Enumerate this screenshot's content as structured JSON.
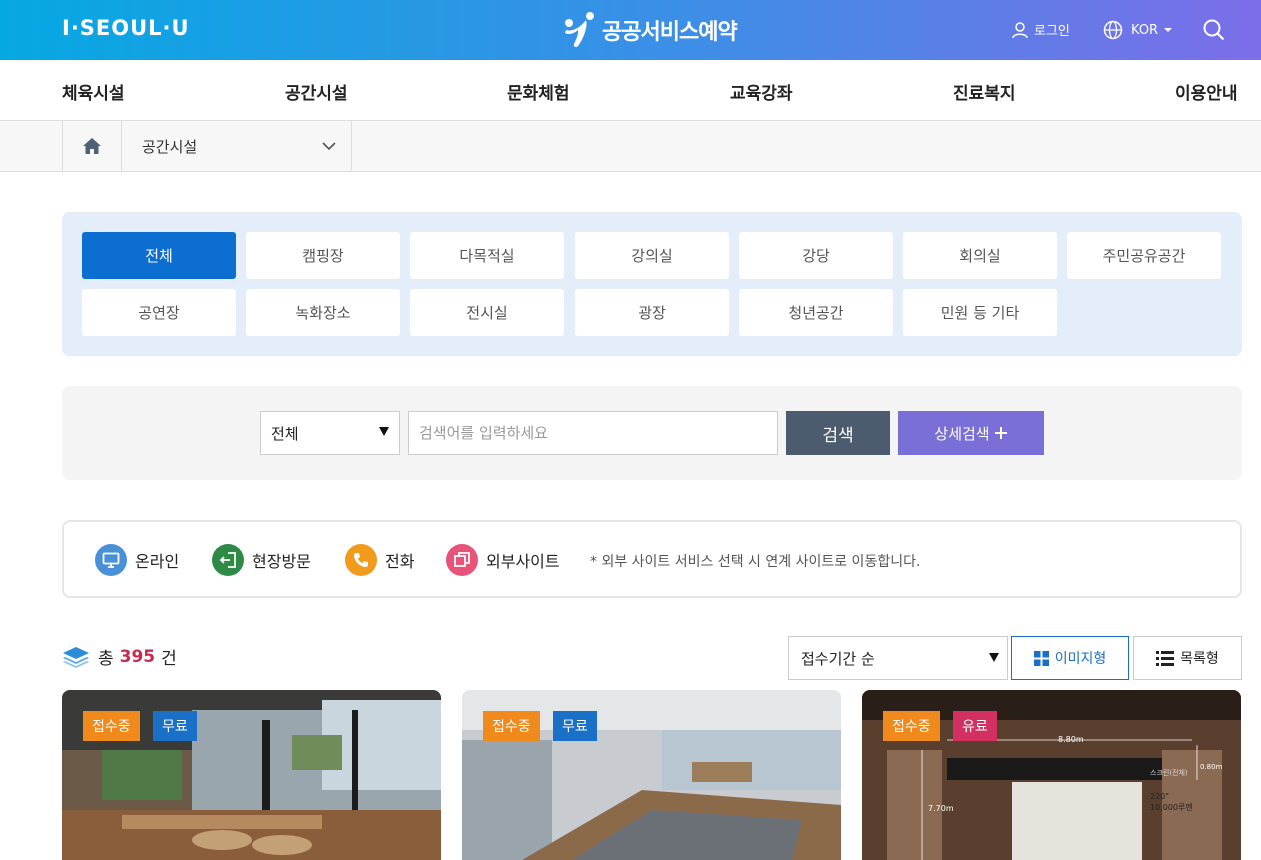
{
  "header": {
    "logo": "I·SEOUL·U",
    "brand": "공공서비스예약",
    "login": "로그인",
    "lang": "KOR"
  },
  "gnb": [
    "체육시설",
    "공간시설",
    "문화체험",
    "교육강좌",
    "진료복지",
    "이용안내"
  ],
  "breadcrumb": {
    "current": "공간시설"
  },
  "categories": [
    "전체",
    "캠핑장",
    "다목적실",
    "강의실",
    "강당",
    "회의실",
    "주민공유공간",
    "공연장",
    "녹화장소",
    "전시실",
    "광장",
    "청년공간",
    "민원 등 기타"
  ],
  "search": {
    "scope": "전체",
    "placeholder": "검색어를 입력하세요",
    "button": "검색",
    "detail": "상세검색"
  },
  "legend": {
    "online": "온라인",
    "visit": "현장방문",
    "phone": "전화",
    "external": "외부사이트",
    "note": "* 외부 사이트 서비스 선택 시 연계 사이트로 이동합니다."
  },
  "results": {
    "prefix": "총",
    "count": "395",
    "suffix": "건",
    "sort": "접수기간 순",
    "view_image": "이미지형",
    "view_list": "목록형"
  },
  "cards": [
    {
      "status": "접수중",
      "fee": "무료"
    },
    {
      "status": "접수중",
      "fee": "무료"
    },
    {
      "status": "접수중",
      "fee": "유료"
    }
  ],
  "card3_overlay": {
    "width": "8.80m",
    "height": "7.70m",
    "screen": "220\"",
    "lumen": "10,000루멘",
    "depth": "0.80m",
    "label": "스크린(전체)"
  },
  "colors": {
    "primary": "#0c6ed0",
    "accent": "#c8294f",
    "purple": "#7a6fd6"
  }
}
